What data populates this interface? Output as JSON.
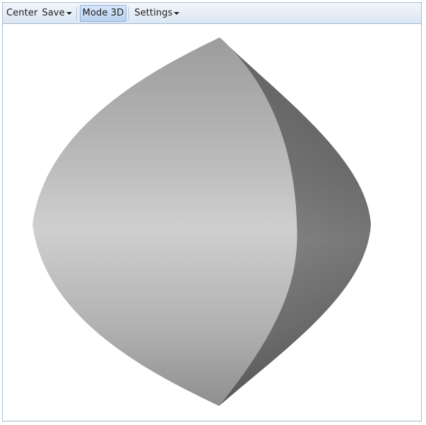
{
  "toolbar": {
    "center_label": "Center",
    "save_label": "Save",
    "mode3d_label": "Mode 3D",
    "settings_label": "Settings"
  },
  "colors": {
    "toolbar_border": "#a6bcd3",
    "active_button": "#b9d1ef",
    "shape_front_light": "#d0d0d0",
    "shape_front_dark": "#999999",
    "shape_side_light": "#8e8e8e",
    "shape_side_dark": "#5f5f5f"
  },
  "icons": {
    "save_dropdown": "chevron-down-icon",
    "settings_dropdown": "chevron-down-icon"
  }
}
